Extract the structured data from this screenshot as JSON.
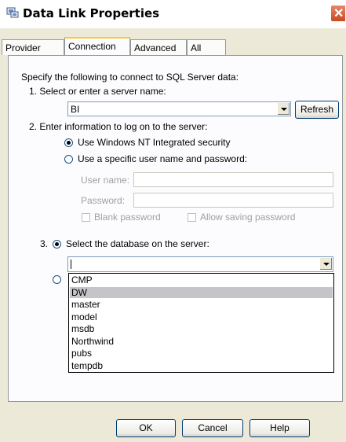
{
  "window": {
    "title": "Data Link Properties"
  },
  "tabs": [
    {
      "label": "Provider"
    },
    {
      "label": "Connection"
    },
    {
      "label": "Advanced"
    },
    {
      "label": "All"
    }
  ],
  "connection": {
    "intro": "Specify the following to connect to SQL Server data:",
    "step1_label": "1. Select or enter a server name:",
    "server_value": "BI",
    "refresh_label": "Refresh",
    "step2_label": "2. Enter information to log on to the server:",
    "radio_nt": "Use Windows NT Integrated security",
    "radio_specific": "Use a specific user name and password:",
    "username_label": "User name:",
    "password_label": "Password:",
    "blank_password": "Blank password",
    "allow_saving": "Allow saving password",
    "step3_label": "3.",
    "select_db_label": "Select the database on the server:",
    "database_value": ""
  },
  "dropdown": {
    "items": [
      "CMP",
      "DW",
      "master",
      "model",
      "msdb",
      "Northwind",
      "pubs",
      "tempdb"
    ],
    "selected": "DW"
  },
  "footer": {
    "ok": "OK",
    "cancel": "Cancel",
    "help": "Help"
  }
}
